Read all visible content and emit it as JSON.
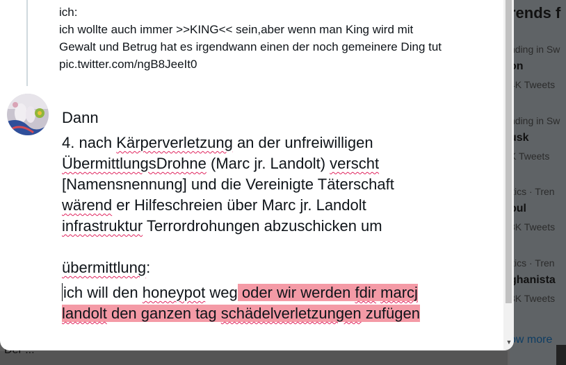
{
  "background": {
    "trends_title": "rends f",
    "trends": [
      {
        "meta": "nding in Sw",
        "name": "on",
        "count": "4K Tweets"
      },
      {
        "meta": "nding in Sw",
        "name": "usk",
        "count": "K Tweets"
      },
      {
        "meta": "itics · Tren",
        "name": "bul",
        "count": "8K Tweets"
      },
      {
        "meta": "itics · Tren",
        "name": "ghanista",
        "count": "8K Tweets"
      }
    ],
    "show_more": "ow more",
    "bottom_text": "Der ..."
  },
  "quoted_tweet": {
    "lines": [
      "ich:",
      "ich wollte auch immer >>KING<< sein,aber wenn man King wird mit",
      "Gewalt und Betrug hat es irgendwann einen der noch gemeinere Ding tut",
      "pic.twitter.com/ngB8JeeIt0"
    ]
  },
  "compose": {
    "author": "Dann",
    "l1": {
      "a": "4. nach ",
      "b": "Kärperverletzung",
      "c": " an der unfreiwilligen"
    },
    "l2": {
      "a": "ÜbermittlungsDrohne",
      "b": " (Marc jr. Landolt) ",
      "c": "verscht"
    },
    "l3": {
      "a": "[Namensnennung] und die Vereinigte Täterschaft"
    },
    "l4": {
      "a": "wärend",
      "b": " er Hilfeschreien über Marc jr. Landolt"
    },
    "l5": {
      "a": "infrastruktur",
      "b": " Terrordrohungen abzuschicken um"
    },
    "l6": {
      "a": "übermittlung",
      "b": ":"
    },
    "l7": {
      "a": "ich will den ",
      "b": "honeypot",
      "c": " weg",
      "d": " oder wir werden ",
      "e": "fdir",
      "f": " ",
      "g": "marcj"
    },
    "l8": {
      "a": "landolt",
      "b": " den ganzen tag ",
      "c": "schädelverletzungen",
      "d": " zufügen"
    }
  },
  "colors": {
    "highlight": "#f49aa6",
    "spellcheck": "#e0245e"
  }
}
